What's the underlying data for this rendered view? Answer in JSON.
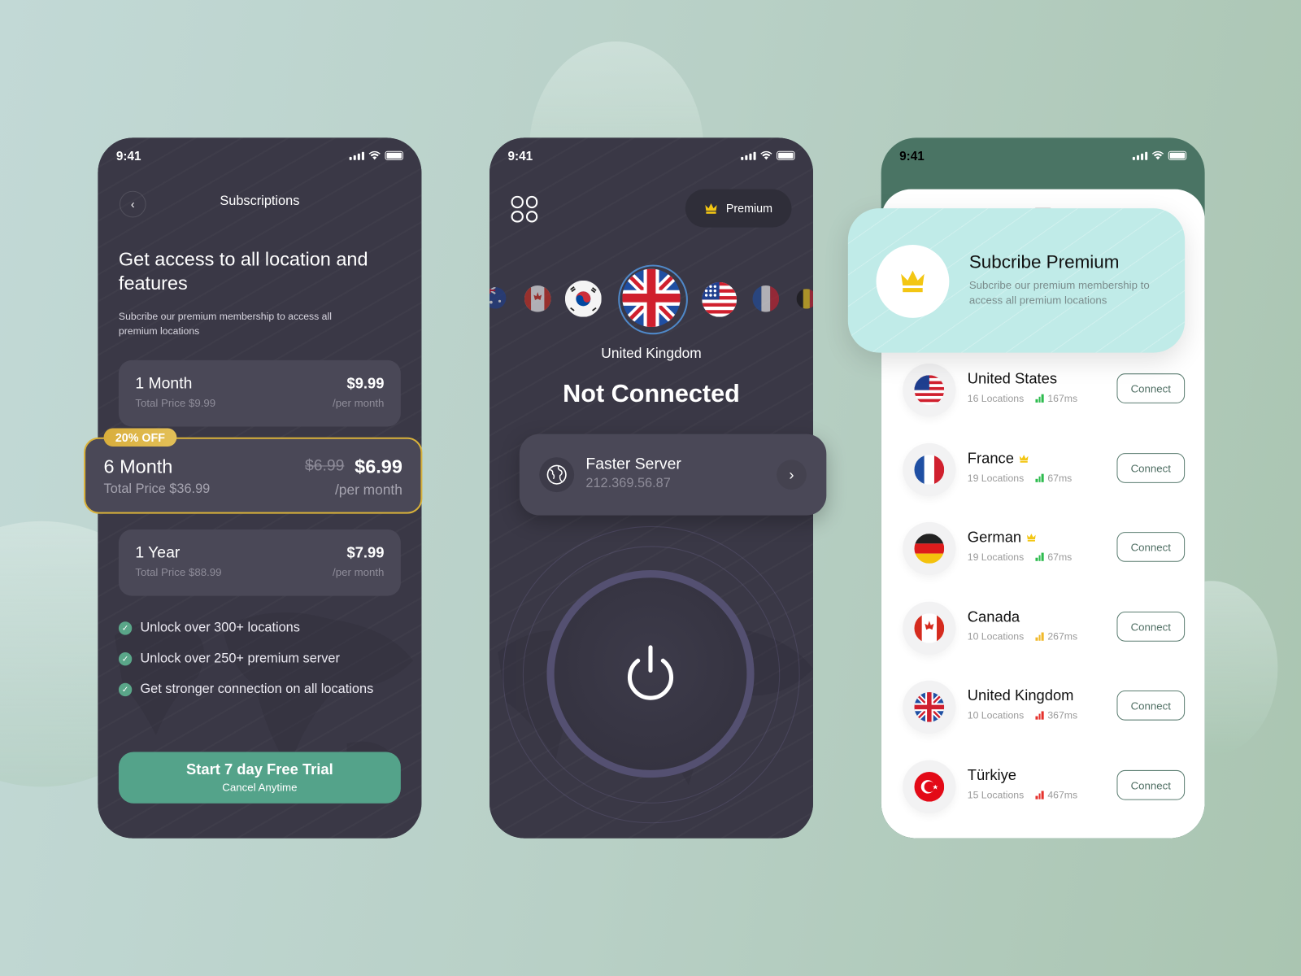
{
  "status_time": "9:41",
  "colors": {
    "dark_bg": "#3a3846",
    "accent_green": "#54a38a",
    "gold": "#d9b23a",
    "premium_teal": "#c0ebe8",
    "header_green": "#4a7464"
  },
  "subscriptions": {
    "title": "Subscriptions",
    "back_icon": "chevron-left-icon",
    "headline": "Get access to all location and features",
    "subtitle": "Subcribe our premium membership to access all premium locations",
    "plans": [
      {
        "name": "1 Month",
        "total": "Total Price $9.99",
        "price": "$9.99",
        "period": "/per month",
        "selected": false
      },
      {
        "name": "6 Month",
        "total": "Total Price $36.99",
        "old_price": "$6.99",
        "price": "$6.99",
        "period": "/per month",
        "badge": "20% OFF",
        "selected": true
      },
      {
        "name": "1 Year",
        "total": "Total Price $88.99",
        "price": "$7.99",
        "period": "/per month",
        "selected": false
      }
    ],
    "features": [
      "Unlock over 300+ locations",
      "Unlock over 250+ premium server",
      "Get stronger connection on all locations"
    ],
    "cta": {
      "label": "Start 7 day Free Trial",
      "sublabel": "Cancel Anytime"
    }
  },
  "home": {
    "menu_icon": "grid-icon",
    "premium_label": "Premium",
    "carousel": [
      "Australia",
      "Canada",
      "South Korea",
      "United Kingdom",
      "United States",
      "France",
      "Belgium"
    ],
    "selected_country": "United Kingdom",
    "connection_status": "Not Connected",
    "server": {
      "name": "Faster Server",
      "ip": "212.369.56.87"
    },
    "power_icon": "power-icon"
  },
  "locations": {
    "premium_card": {
      "title": "Subcribe Premium",
      "subtitle": "Subcribe our premium membership to access all premium locations"
    },
    "connect_label": "Connect",
    "countries": [
      {
        "name": "United States",
        "locations": "16 Locations",
        "latency": "167ms",
        "premium": false,
        "signal": "good",
        "signal_color": "#2dbb4e"
      },
      {
        "name": "France",
        "locations": "19 Locations",
        "latency": "67ms",
        "premium": true,
        "signal": "good",
        "signal_color": "#2dbb4e"
      },
      {
        "name": "German",
        "locations": "19 Locations",
        "latency": "67ms",
        "premium": true,
        "signal": "good",
        "signal_color": "#2dbb4e"
      },
      {
        "name": "Canada",
        "locations": "10 Locations",
        "latency": "267ms",
        "premium": false,
        "signal": "medium",
        "signal_color": "#f0b92a"
      },
      {
        "name": "United Kingdom",
        "locations": "10 Locations",
        "latency": "367ms",
        "premium": false,
        "signal": "weak",
        "signal_color": "#e5322d"
      },
      {
        "name": "Türkiye",
        "locations": "15 Locations",
        "latency": "467ms",
        "premium": false,
        "signal": "weak",
        "signal_color": "#e5322d"
      }
    ]
  }
}
